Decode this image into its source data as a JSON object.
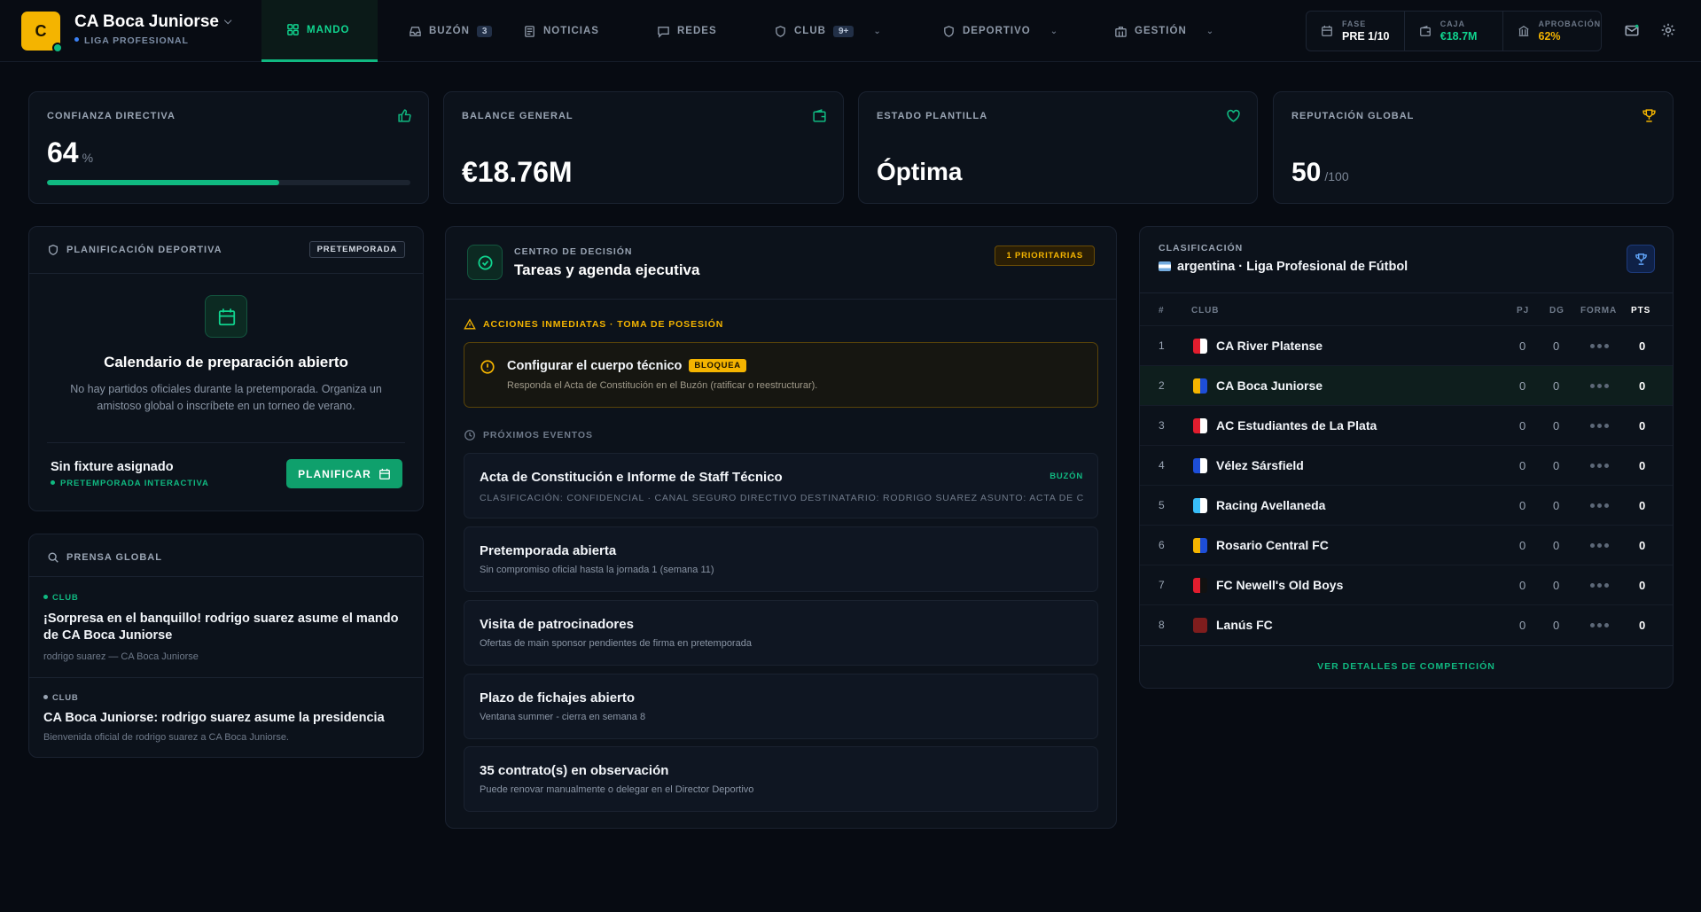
{
  "header": {
    "badge_letter": "C",
    "club_name": "CA Boca Juniorse",
    "league": "LIGA PROFESIONAL"
  },
  "nav": [
    {
      "label": "MANDO",
      "icon": "grid-icon",
      "active": true
    },
    {
      "label": "BUZÓN",
      "icon": "inbox-icon",
      "count": "3"
    },
    {
      "label": "NOTICIAS",
      "icon": "newspaper-icon"
    },
    {
      "label": "REDES",
      "icon": "chat-icon"
    },
    {
      "label": "CLUB",
      "icon": "shield-icon",
      "count": "9+",
      "dropdown": true
    },
    {
      "label": "DEPORTIVO",
      "icon": "shield-icon",
      "dropdown": true
    },
    {
      "label": "GESTIÓN",
      "icon": "briefcase-icon",
      "dropdown": true
    }
  ],
  "stats": [
    {
      "label": "FASE",
      "value": "PRE 1/10",
      "icon": "calendar-icon",
      "color": "#ffffff"
    },
    {
      "label": "CAJA",
      "value": "€18.7M",
      "icon": "wallet-icon",
      "color": "#10d58f"
    },
    {
      "label": "APROBACIÓN",
      "value": "62%",
      "icon": "bank-icon",
      "color": "#f4b400"
    }
  ],
  "kpis": {
    "confianza": {
      "label": "CONFIANZA DIRECTIVA",
      "value": "64",
      "unit": "%",
      "progress": 0.64
    },
    "balance": {
      "label": "BALANCE GENERAL",
      "value": "€18.76M"
    },
    "plantilla": {
      "label": "ESTADO PLANTILLA",
      "value": "Óptima"
    },
    "reputacion": {
      "label": "REPUTACIÓN GLOBAL",
      "value": "50",
      "unit": "/100"
    }
  },
  "planning": {
    "title": "PLANIFICACIÓN DEPORTIVA",
    "tag": "PRETEMPORADA",
    "heading": "Calendario de preparación abierto",
    "text": "No hay partidos oficiales durante la pretemporada. Organiza un amistoso global o inscríbete en un torneo de verano.",
    "fixture_title": "Sin fixture asignado",
    "fixture_sub": "PRETEMPORADA INTERACTIVA",
    "button": "PLANIFICAR"
  },
  "press": {
    "title": "PRENSA GLOBAL",
    "items": [
      {
        "tag": "CLUB",
        "headline": "¡Sorpresa en el banquillo! rodrigo suarez asume el mando de CA Boca Juniorse",
        "byline": "rodrigo suarez — CA Boca Juniorse"
      },
      {
        "tag": "CLUB",
        "headline": "CA Boca Juniorse: rodrigo suarez asume la presidencia",
        "byline": "Bienvenida oficial de rodrigo suarez a CA Boca Juniorse."
      }
    ]
  },
  "decision": {
    "kicker": "CENTRO DE DECISIÓN",
    "title": "Tareas y agenda ejecutiva",
    "priority": "1 PRIORITARIAS",
    "immediate_label": "ACCIONES INMEDIATAS · TOMA DE POSESIÓN",
    "alert_title": "Configurar el cuerpo técnico",
    "alert_tag": "BLOQUEA",
    "alert_text": "Responda el Acta de Constitución en el Buzón (ratificar o reestructurar).",
    "upcoming_label": "PRÓXIMOS EVENTOS",
    "events": [
      {
        "title": "Acta de Constitución e Informe de Staff Técnico",
        "tag": "BUZÓN",
        "desc": "CLASIFICACIÓN: CONFIDENCIAL · CANAL SEGURO DIRECTIVO DESTINATARIO: RODRIGO SUAREZ ASUNTO: ACTA DE CO"
      },
      {
        "title": "Pretemporada abierta",
        "desc": "Sin compromiso oficial hasta la jornada 1 (semana 11)"
      },
      {
        "title": "Visita de patrocinadores",
        "desc": "Ofertas de main sponsor pendientes de firma en pretemporada"
      },
      {
        "title": "Plazo de fichajes abierto",
        "desc": "Ventana summer - cierra en semana 8"
      },
      {
        "title": "35 contrato(s) en observación",
        "desc": "Puede renovar manualmente o delegar en el Director Deportivo"
      }
    ]
  },
  "standings": {
    "kicker": "CLASIFICACIÓN",
    "title": "argentina · Liga Profesional de Fútbol",
    "columns": [
      "#",
      "CLUB",
      "PJ",
      "DG",
      "FORMA",
      "PTS"
    ],
    "rows": [
      {
        "pos": "1",
        "club": "CA River Platense",
        "pj": "0",
        "dg": "0",
        "pts": "0",
        "colors": [
          "#e11d2e",
          "#ffffff"
        ]
      },
      {
        "pos": "2",
        "club": "CA Boca Juniorse",
        "pj": "0",
        "dg": "0",
        "pts": "0",
        "colors": [
          "#f4b400",
          "#1d4ed8"
        ],
        "highlight": true
      },
      {
        "pos": "3",
        "club": "AC Estudiantes de La Plata",
        "pj": "0",
        "dg": "0",
        "pts": "0",
        "colors": [
          "#e11d2e",
          "#ffffff"
        ]
      },
      {
        "pos": "4",
        "club": "Vélez Sársfield",
        "pj": "0",
        "dg": "0",
        "pts": "0",
        "colors": [
          "#1d4ed8",
          "#ffffff"
        ]
      },
      {
        "pos": "5",
        "club": "Racing Avellaneda",
        "pj": "0",
        "dg": "0",
        "pts": "0",
        "colors": [
          "#38bdf8",
          "#ffffff"
        ]
      },
      {
        "pos": "6",
        "club": "Rosario Central FC",
        "pj": "0",
        "dg": "0",
        "pts": "0",
        "colors": [
          "#f4b400",
          "#1d4ed8"
        ]
      },
      {
        "pos": "7",
        "club": "FC Newell's Old Boys",
        "pj": "0",
        "dg": "0",
        "pts": "0",
        "colors": [
          "#e11d2e",
          "#111111"
        ]
      },
      {
        "pos": "8",
        "club": "Lanús FC",
        "pj": "0",
        "dg": "0",
        "pts": "0",
        "colors": [
          "#7f1d1d",
          "#7f1d1d"
        ]
      }
    ],
    "footer_link": "VER DETALLES DE COMPETICIÓN"
  }
}
